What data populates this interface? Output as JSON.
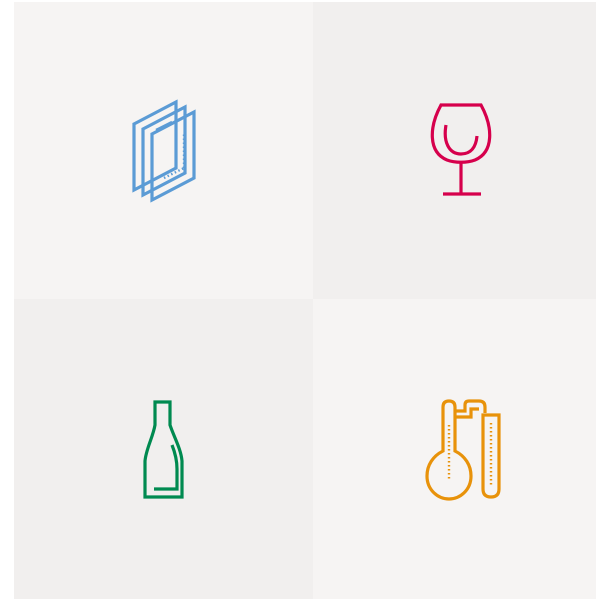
{
  "tiles": [
    {
      "icon": "glass-panes-icon",
      "color": "#5b9bd5",
      "background": "#f6f4f3"
    },
    {
      "icon": "wine-glass-icon",
      "color": "#d6004c",
      "background": "#f1efee"
    },
    {
      "icon": "bottle-icon",
      "color": "#008a50",
      "background": "#f1efee"
    },
    {
      "icon": "lab-flask-tubes-icon",
      "color": "#e8920a",
      "background": "#f6f4f3"
    }
  ]
}
